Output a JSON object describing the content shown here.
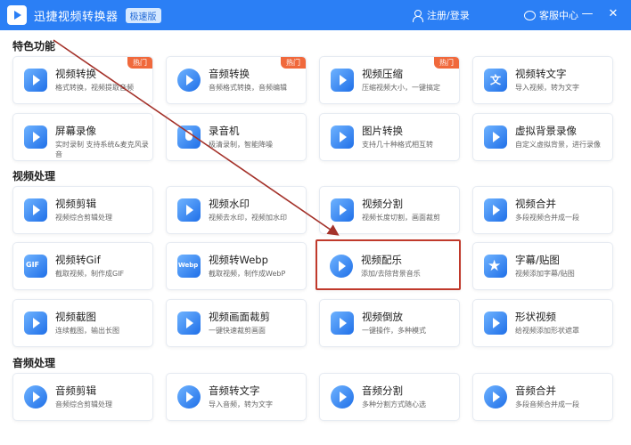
{
  "titlebar": {
    "app_title": "迅捷视频转换器",
    "edition_badge": "极速版",
    "login_label": "注册/登录",
    "support_label": "客服中心",
    "minimize_glyph": "—",
    "close_glyph": "✕"
  },
  "sections": {
    "featured": "特色功能",
    "video": "视频处理",
    "audio": "音频处理"
  },
  "hot_badge": "热门",
  "featured_items": [
    {
      "title": "视频转换",
      "desc": "格式转换，视频提取音频",
      "icon": "video-convert-icon",
      "hot": true
    },
    {
      "title": "音频转换",
      "desc": "音频格式转换，音频编辑",
      "icon": "audio-convert-icon",
      "hot": true
    },
    {
      "title": "视频压缩",
      "desc": "压缩视频大小，一键搞定",
      "icon": "video-compress-icon",
      "hot": true
    },
    {
      "title": "视频转文字",
      "desc": "导入视频，转为文字",
      "icon": "video-to-text-icon",
      "hot": false
    },
    {
      "title": "屏幕录像",
      "desc": "实时录制 支持系统&麦克风录音",
      "icon": "screen-record-icon",
      "hot": false
    },
    {
      "title": "录音机",
      "desc": "极清录制，智能降噪",
      "icon": "recorder-icon",
      "hot": false
    },
    {
      "title": "图片转换",
      "desc": "支持几十种格式相互转",
      "icon": "image-convert-icon",
      "hot": false
    },
    {
      "title": "虚拟背景录像",
      "desc": "自定义虚拟背景，进行录像",
      "icon": "virtual-bg-icon",
      "hot": false
    }
  ],
  "video_items": [
    {
      "title": "视频剪辑",
      "desc": "视频综合剪辑处理",
      "icon": "video-edit-icon"
    },
    {
      "title": "视频水印",
      "desc": "视频去水印，视频加水印",
      "icon": "watermark-icon"
    },
    {
      "title": "视频分割",
      "desc": "视频长度切割，画面裁剪",
      "icon": "video-split-icon"
    },
    {
      "title": "视频合并",
      "desc": "多段视频合并成一段",
      "icon": "video-merge-icon"
    },
    {
      "title": "视频转Gif",
      "desc": "截取视频，制作成GIF",
      "icon": "gif-icon"
    },
    {
      "title": "视频转Webp",
      "desc": "截取视频，制作成WebP",
      "icon": "webp-icon"
    },
    {
      "title": "视频配乐",
      "desc": "添加/去除背景音乐",
      "icon": "video-music-icon"
    },
    {
      "title": "字幕/贴图",
      "desc": "视频添加字幕/贴图",
      "icon": "subtitle-sticker-icon"
    },
    {
      "title": "视频截图",
      "desc": "连续截图，输出长图",
      "icon": "screenshot-icon"
    },
    {
      "title": "视频画面裁剪",
      "desc": "一键快速裁剪画面",
      "icon": "crop-icon"
    },
    {
      "title": "视频倒放",
      "desc": "一键操作，多种模式",
      "icon": "reverse-icon"
    },
    {
      "title": "形状视频",
      "desc": "给视频添加形状遮罩",
      "icon": "shape-video-icon"
    }
  ],
  "audio_items": [
    {
      "title": "音频剪辑",
      "desc": "音频综合剪辑处理",
      "icon": "audio-edit-icon"
    },
    {
      "title": "音频转文字",
      "desc": "导入音频，转为文字",
      "icon": "audio-to-text-icon"
    },
    {
      "title": "音频分割",
      "desc": "多种分割方式随心选",
      "icon": "audio-split-icon"
    },
    {
      "title": "音频合并",
      "desc": "多段音频合并成一段",
      "icon": "audio-merge-icon"
    }
  ],
  "colors": {
    "accent": "#2b7ff5",
    "hot": "#f0693c",
    "highlight": "#c0392b"
  }
}
